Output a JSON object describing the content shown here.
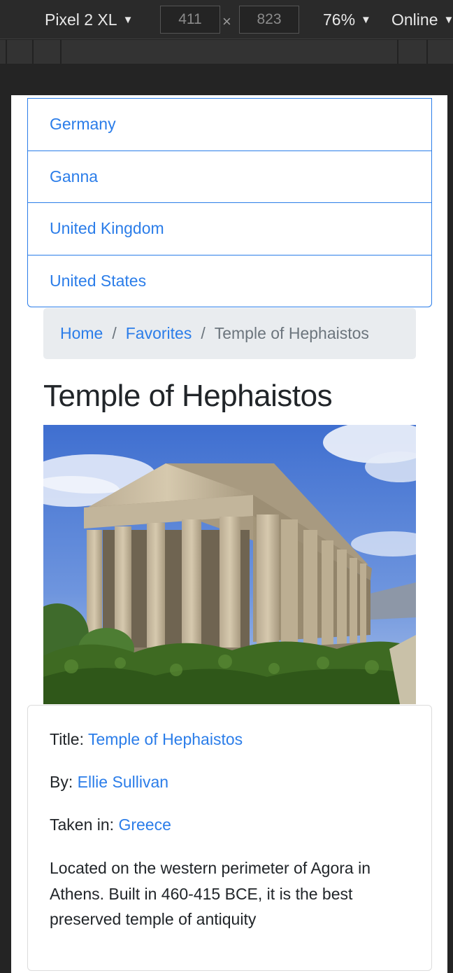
{
  "devtools": {
    "device": "Pixel 2 XL",
    "width": "411",
    "height": "823",
    "times": "×",
    "zoom": "76%",
    "network": "Online",
    "caret": "▼"
  },
  "countries": [
    "Germany",
    "Ganna",
    "United Kingdom",
    "United States"
  ],
  "breadcrumb": {
    "home": "Home",
    "favorites": "Favorites",
    "current": "Temple of Hephaistos",
    "separator": "/"
  },
  "page": {
    "title": "Temple of Hephaistos"
  },
  "details": {
    "title_label": "Title:",
    "title_value": "Temple of Hephaistos",
    "by_label": "By:",
    "by_value": "Ellie Sullivan",
    "taken_label": "Taken in:",
    "taken_value": "Greece",
    "description": "Located on the western perimeter of Agora in Athens. Built in 460-415 BCE, it is the best preserved temple of antiquity"
  },
  "colors": {
    "link": "#2b7de9",
    "breadcrumb_bg": "#e9ecef",
    "devtools_bg": "#2a2a2a"
  }
}
